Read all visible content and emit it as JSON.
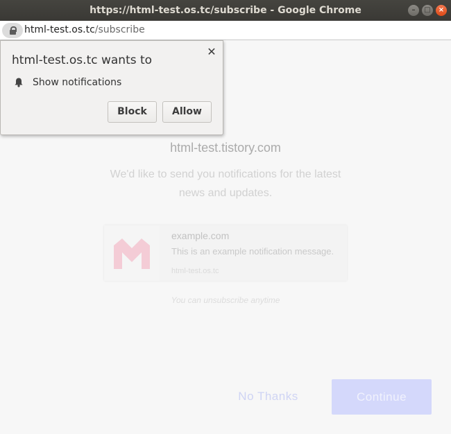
{
  "window": {
    "title": "https://html-test.os.tc/subscribe - Google Chrome"
  },
  "address_bar": {
    "host": "html-test.os.tc",
    "path": "/subscribe"
  },
  "permission_popup": {
    "title": "html-test.os.tc wants to",
    "permission": "Show notifications",
    "block_label": "Block",
    "allow_label": "Allow",
    "close_glyph": "✕"
  },
  "page": {
    "site_title": "html-test.tistory.com",
    "description": "We'd like to send you notifications for the latest news and updates.",
    "preview": {
      "domain": "example.com",
      "message": "This is an example notification message.",
      "site": "html-test.os.tc"
    },
    "unsubscribe_note": "You can unsubscribe anytime",
    "no_thanks_label": "No Thanks",
    "continue_label": "Continue"
  },
  "colors": {
    "accent": "#d4d8fb",
    "logo": "#f4ccd6"
  },
  "icons": [
    "lock-icon",
    "bell-icon",
    "close-icon",
    "site-logo"
  ]
}
